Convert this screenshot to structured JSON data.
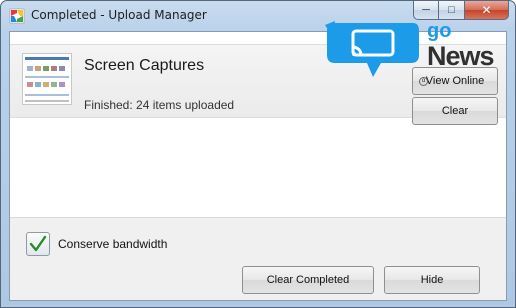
{
  "window": {
    "title": "Completed - Upload Manager",
    "caption_buttons": {
      "minimize": "─",
      "maximize": "□",
      "close": "✕"
    }
  },
  "upload": {
    "title": "Screen Captures",
    "status": "Finished: 24 items uploaded",
    "view_online_label": "View Online",
    "clear_label": "Clear"
  },
  "options": {
    "conserve_bandwidth_label": "Conserve bandwidth",
    "conserve_bandwidth_checked": true
  },
  "footer": {
    "clear_completed_label": "Clear Completed",
    "hide_label": "Hide"
  },
  "watermark": {
    "line1": "go",
    "line2": "News"
  },
  "colors": {
    "accent": "#1b9be8",
    "check": "#2b8a2b",
    "close_button": "#c4442a"
  },
  "icons": {
    "app": "picasa-icon",
    "check": "checkmark-icon",
    "watermark": "cast-chat-icon"
  }
}
